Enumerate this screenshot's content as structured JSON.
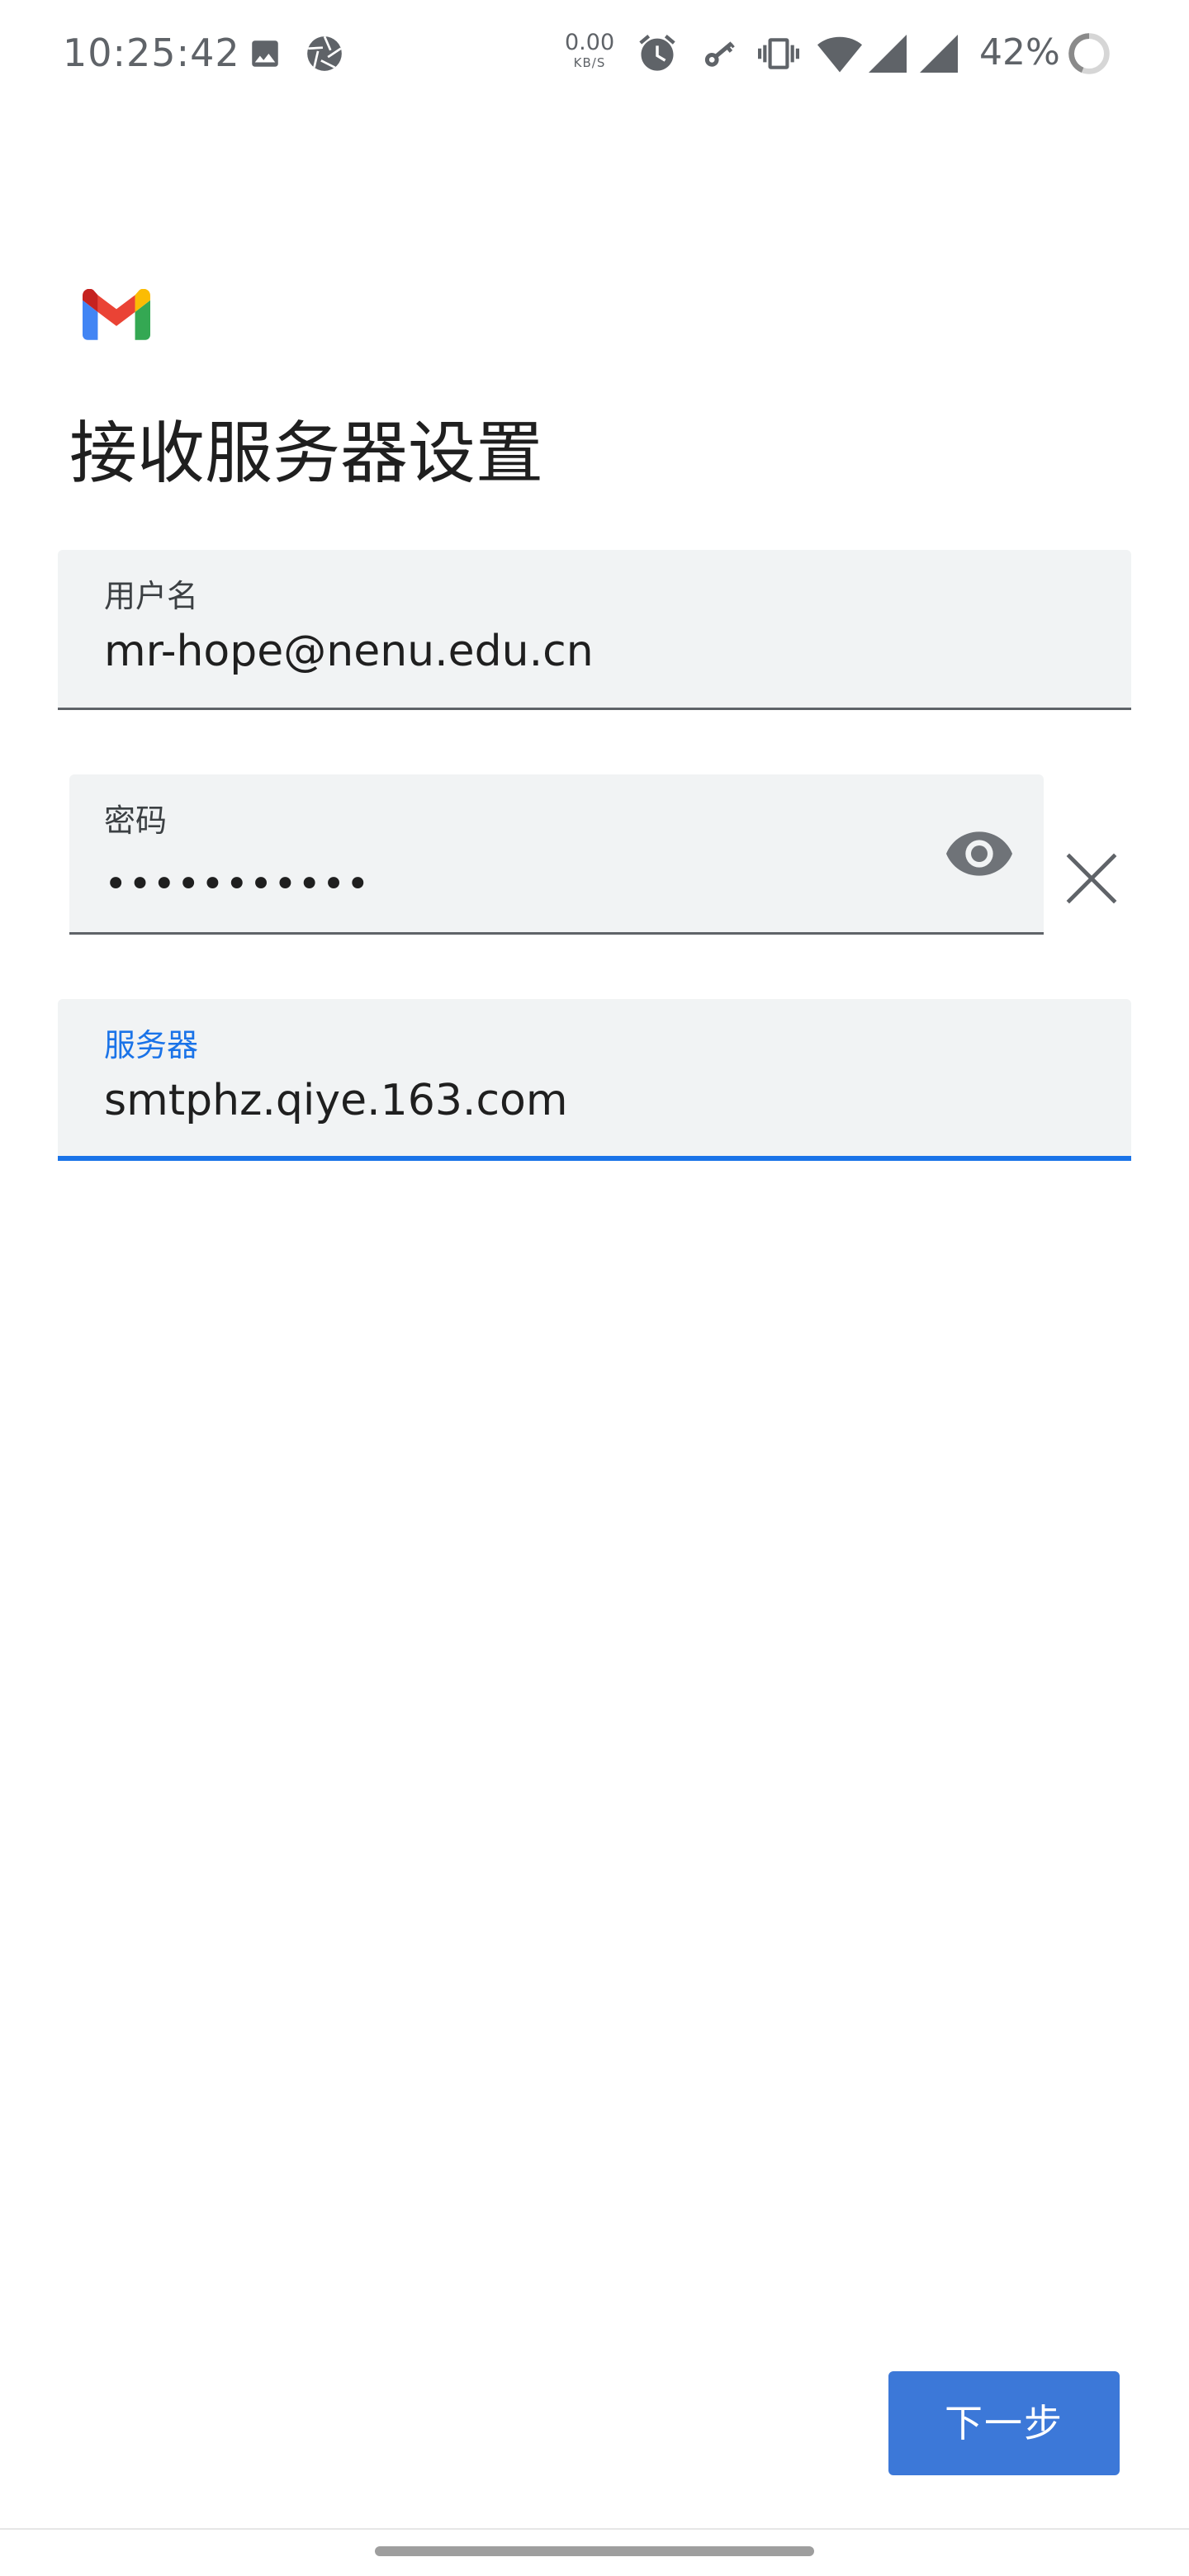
{
  "status_bar": {
    "time": "10:25:42",
    "network_speed_value": "0.00",
    "network_speed_unit": "KB/S",
    "battery_percent": "42%",
    "icons": [
      "image-icon",
      "aperture-icon",
      "alarm-icon",
      "key-icon",
      "vibrate-icon",
      "wifi-icon",
      "signal-icon",
      "signal-icon",
      "battery-ring-icon"
    ]
  },
  "header": {
    "logo": "gmail-logo",
    "title": "接收服务器设置"
  },
  "form": {
    "username": {
      "label": "用户名",
      "value": "mr-hope@nenu.edu.cn"
    },
    "password": {
      "label": "密码",
      "value": "•••••••••••",
      "toggle_icon": "eye-icon",
      "clear_icon": "close-icon"
    },
    "server": {
      "label": "服务器",
      "value": "smtphz.qiye.163.com"
    }
  },
  "footer": {
    "next_label": "下一步"
  },
  "colors": {
    "accent": "#1a73e8",
    "button": "#3c78d8",
    "field_bg": "#f1f3f4",
    "gmail_red": "#ea4335",
    "gmail_blue": "#4285f4",
    "gmail_green": "#34a853",
    "gmail_yellow": "#fbbc04"
  }
}
